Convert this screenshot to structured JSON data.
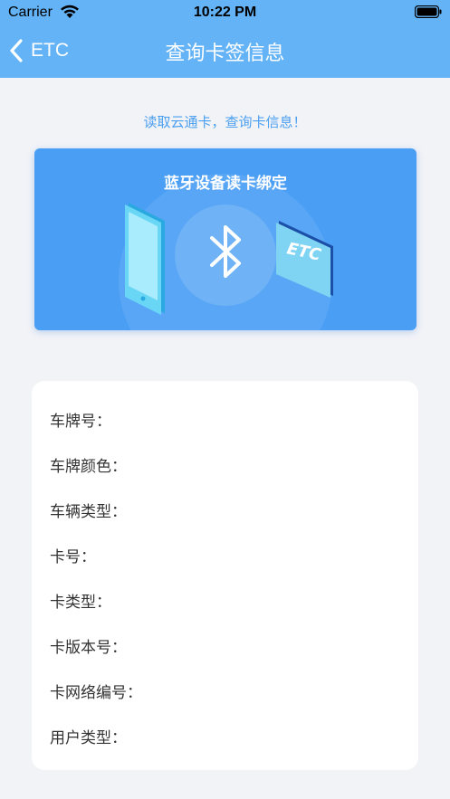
{
  "status_bar": {
    "carrier": "Carrier",
    "time": "10:22 PM"
  },
  "nav": {
    "back_label": "ETC",
    "title": "查询卡签信息"
  },
  "hint_text": "读取云通卡，查询卡信息！",
  "banner": {
    "title": "蓝牙设备读卡绑定",
    "card_text": "ETC"
  },
  "info_rows": [
    "车牌号：",
    "车牌颜色：",
    "车辆类型：",
    "卡号：",
    "卡类型：",
    "卡版本号：",
    "卡网络编号：",
    "用户类型："
  ],
  "colors": {
    "nav_bg": "#64b3f6",
    "banner_bg": "#4a9ff5",
    "hint": "#4a9ff0",
    "page_bg": "#f2f3f7"
  }
}
